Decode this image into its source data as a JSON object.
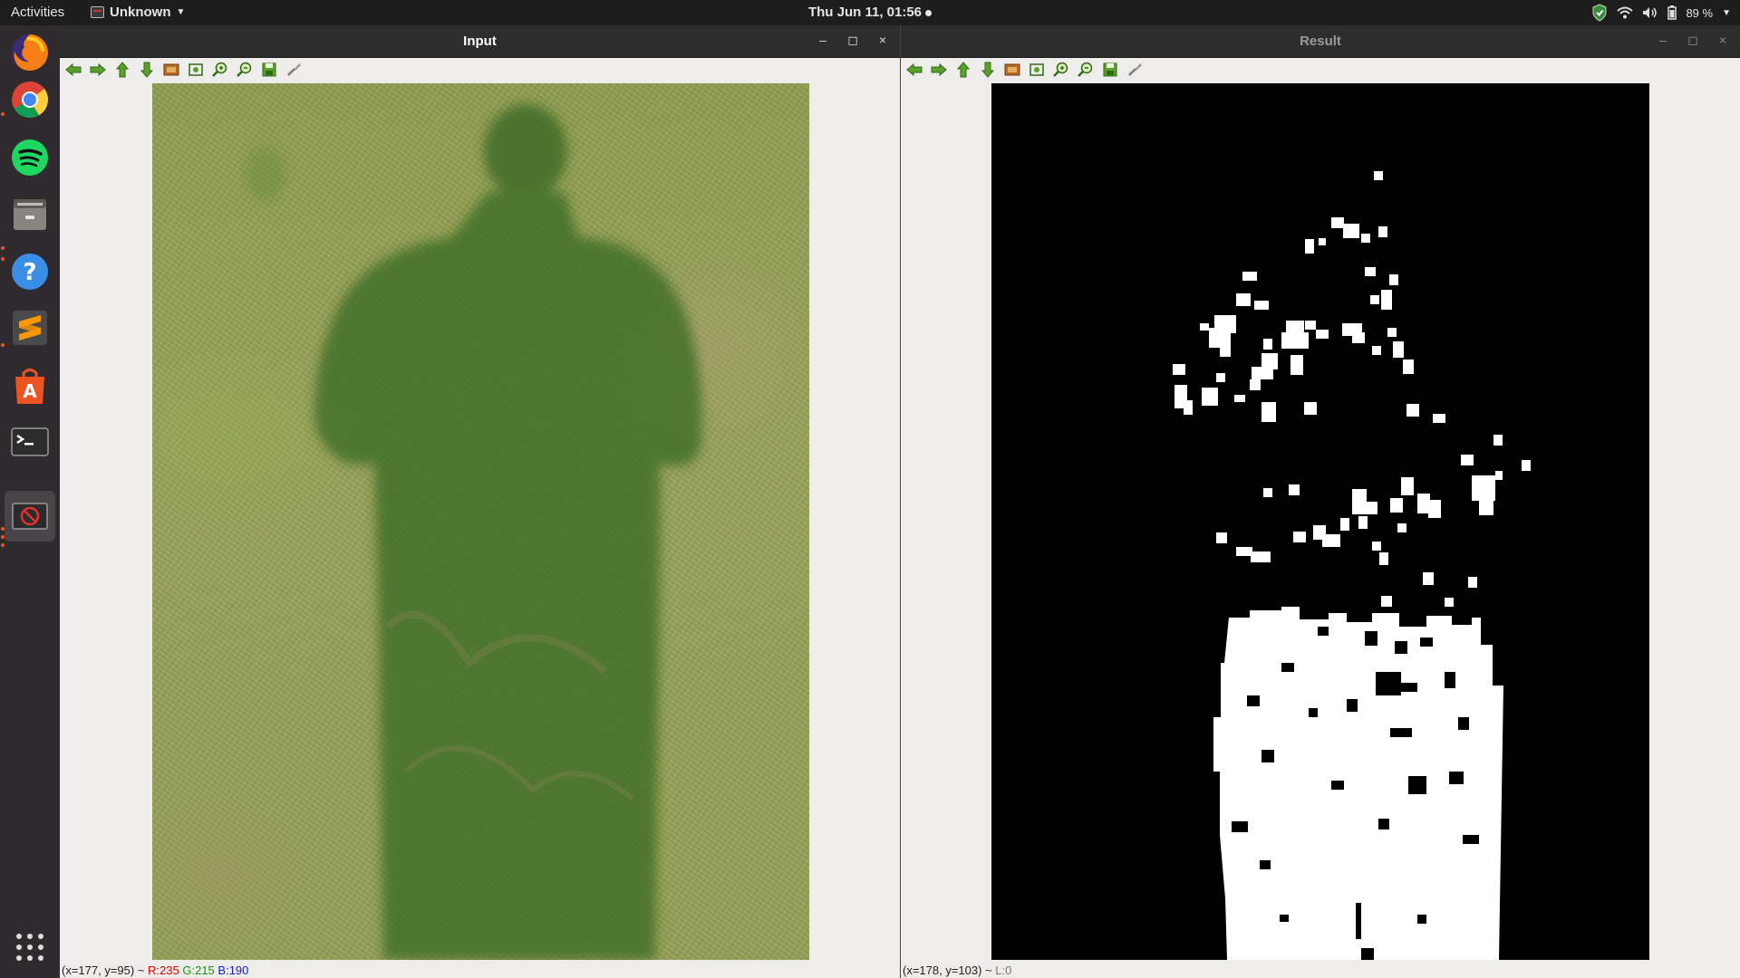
{
  "topbar": {
    "activities": "Activities",
    "app_name": "Unknown",
    "clock": "Thu Jun 11, 01:56",
    "battery": "89 %"
  },
  "dock": {
    "items": [
      "firefox-icon",
      "chrome-icon",
      "spotify-icon",
      "files-icon",
      "help-icon",
      "sublime-text-icon",
      "software-center-icon",
      "terminal-icon",
      "opencv-window-icon",
      "show-apps-icon"
    ]
  },
  "windows": {
    "input": {
      "title": "Input",
      "status": {
        "coords": "(x=177, y=95) ~",
        "r": "R:235",
        "g": "G:215",
        "b": "B:190"
      }
    },
    "result": {
      "title": "Result",
      "status": {
        "coords": "(x=178, y=103) ~",
        "l": "L:0"
      }
    }
  },
  "toolbar_icons": [
    "pan-left-icon",
    "pan-right-icon",
    "pan-up-icon",
    "pan-down-icon",
    "zoom-fit-icon",
    "zoom-original-icon",
    "zoom-in-icon",
    "zoom-out-icon",
    "save-icon",
    "properties-icon"
  ],
  "colors": {
    "accent": "#e95420",
    "toolbar_green": "#5aa02c",
    "titlebar": "#2d2d2d",
    "dock": "#2e2a2e"
  }
}
